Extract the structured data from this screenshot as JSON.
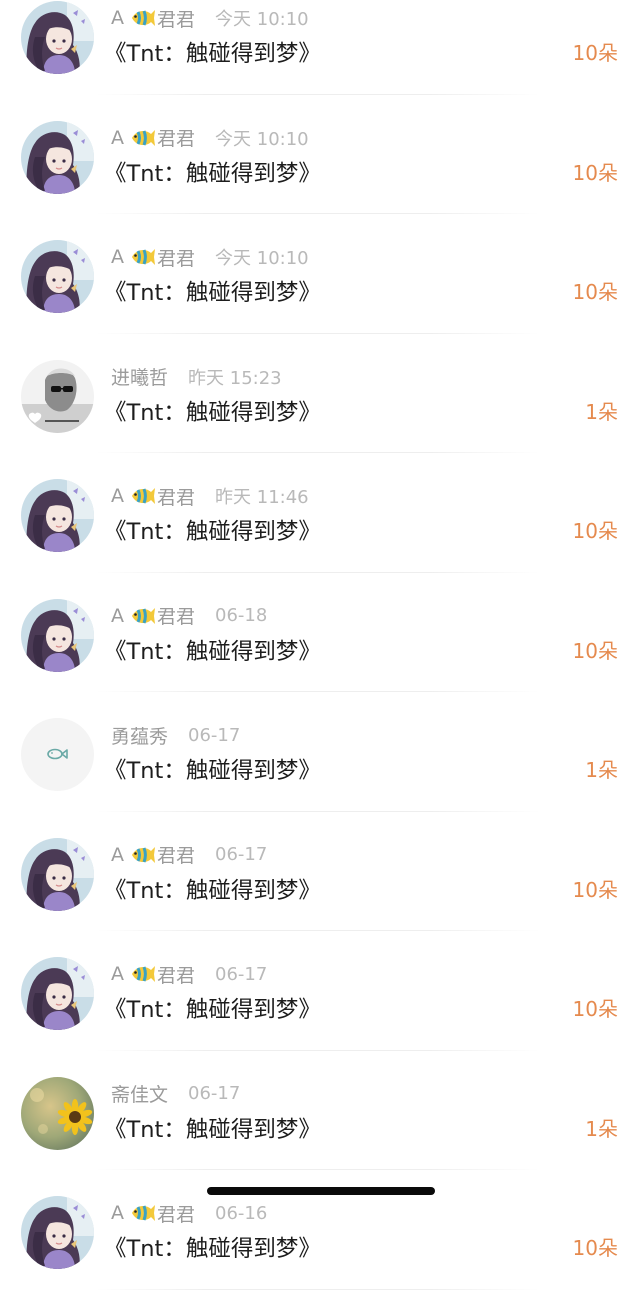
{
  "gift_list": [
    {
      "avatar": "girl-avatar",
      "name_prefix": "A",
      "name_suffix": "君君",
      "name_emoji": "fish-emoji",
      "time": "今天 10:10",
      "title": "《Tnt：触碰得到梦》",
      "count": "10朵"
    },
    {
      "avatar": "girl-avatar",
      "name_prefix": "A",
      "name_suffix": "君君",
      "name_emoji": "fish-emoji",
      "time": "今天 10:10",
      "title": "《Tnt：触碰得到梦》",
      "count": "10朵"
    },
    {
      "avatar": "girl-avatar",
      "name_prefix": "A",
      "name_suffix": "君君",
      "name_emoji": "fish-emoji",
      "time": "今天 10:10",
      "title": "《Tnt：触碰得到梦》",
      "count": "10朵"
    },
    {
      "avatar": "sunglasses-avatar",
      "name_prefix": "进曦哲",
      "name_suffix": "",
      "name_emoji": "",
      "time": "昨天 15:23",
      "title": "《Tnt：触碰得到梦》",
      "count": "1朵"
    },
    {
      "avatar": "girl-avatar",
      "name_prefix": "A",
      "name_suffix": "君君",
      "name_emoji": "fish-emoji",
      "time": "昨天 11:46",
      "title": "《Tnt：触碰得到梦》",
      "count": "10朵"
    },
    {
      "avatar": "girl-avatar",
      "name_prefix": "A",
      "name_suffix": "君君",
      "name_emoji": "fish-emoji",
      "time": "06-18",
      "title": "《Tnt：触碰得到梦》",
      "count": "10朵"
    },
    {
      "avatar": "default-fish-avatar",
      "name_prefix": "勇蕴秀",
      "name_suffix": "",
      "name_emoji": "",
      "time": "06-17",
      "title": "《Tnt：触碰得到梦》",
      "count": "1朵"
    },
    {
      "avatar": "girl-avatar",
      "name_prefix": "A",
      "name_suffix": "君君",
      "name_emoji": "fish-emoji",
      "time": "06-17",
      "title": "《Tnt：触碰得到梦》",
      "count": "10朵"
    },
    {
      "avatar": "girl-avatar",
      "name_prefix": "A",
      "name_suffix": "君君",
      "name_emoji": "fish-emoji",
      "time": "06-17",
      "title": "《Tnt：触碰得到梦》",
      "count": "10朵"
    },
    {
      "avatar": "sunflower-avatar",
      "name_prefix": "斋佳文",
      "name_suffix": "",
      "name_emoji": "",
      "time": "06-17",
      "title": "《Tnt：触碰得到梦》",
      "count": "1朵"
    },
    {
      "avatar": "girl-avatar",
      "name_prefix": "A",
      "name_suffix": "君君",
      "name_emoji": "fish-emoji",
      "time": "06-16",
      "title": "《Tnt：触碰得到梦》",
      "count": "10朵"
    }
  ],
  "colors": {
    "count": "#e58a4e",
    "title": "#1d1d1d",
    "name": "#9b9b9b",
    "time": "#b9b9b9",
    "divider": "#eeeeee"
  }
}
